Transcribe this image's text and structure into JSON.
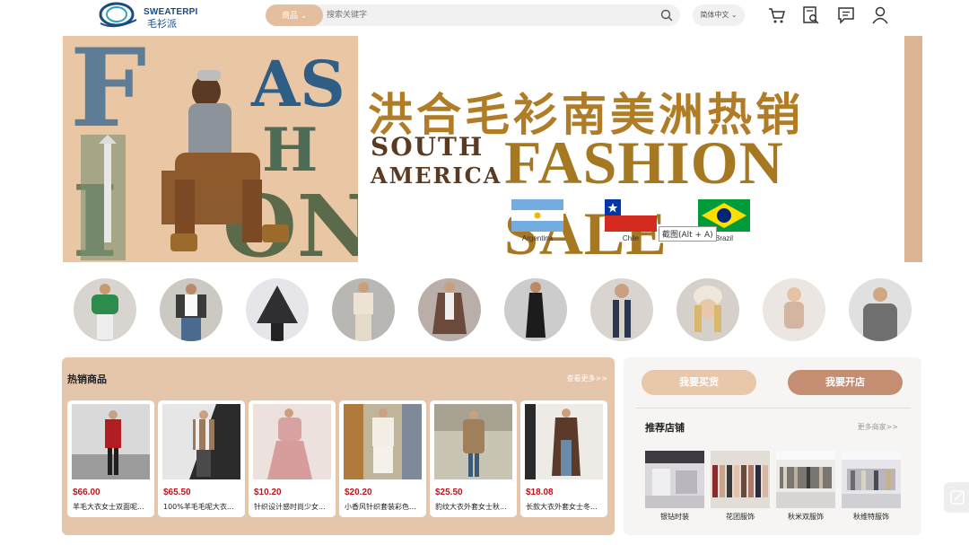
{
  "header": {
    "brand_en": "SWEATERPI",
    "brand_cn": "毛衫派",
    "search_category": "商品",
    "search_placeholder": "搜索关键字",
    "language": "简体中文",
    "icons": [
      "cart-icon",
      "order-search-icon",
      "message-icon",
      "user-icon"
    ]
  },
  "banner": {
    "title_cn": "洪合毛衫南美洲热销",
    "south": "SOUTH",
    "america": "AMERICA",
    "fashion_sale": "FASHION SALE",
    "flags": [
      {
        "label": "Argentina"
      },
      {
        "label": "Chile"
      },
      {
        "label": "Brazil"
      }
    ],
    "tooltip": "截图(Alt + A)"
  },
  "categories": [
    "green-crop-top",
    "cardigan-jeans",
    "poncho-cape",
    "knit-set",
    "long-coat",
    "black-dress",
    "scarf",
    "knit-hat",
    "baby-romper",
    "mens-sweater"
  ],
  "hot": {
    "title": "热销商品",
    "more": "查看更多>>",
    "products": [
      {
        "price": "$66.00",
        "name": "羊毛大衣女士双面呢..."
      },
      {
        "price": "$65.50",
        "name": "100%羊毛毛呢大衣..."
      },
      {
        "price": "$10.20",
        "name": "针织设计感时尚少女..."
      },
      {
        "price": "$20.20",
        "name": "小香风针织套装彩色..."
      },
      {
        "price": "$25.50",
        "name": "豹纹大衣外套女士秋..."
      },
      {
        "price": "$18.08",
        "name": "长款大衣外套女士冬..."
      }
    ]
  },
  "shops": {
    "buy_label": "我要买货",
    "open_label": "我要开店",
    "title": "推荐店铺",
    "more": "更多商家>>",
    "items": [
      {
        "name": "银钻时装"
      },
      {
        "name": "花团服饰"
      },
      {
        "name": "秋米双服饰"
      },
      {
        "name": "秋维特服饰"
      }
    ]
  },
  "colors": {
    "accent": "#e3bfa0",
    "accent_dark": "#c89a7a",
    "price": "#c0141b",
    "gold": "#a57821"
  }
}
